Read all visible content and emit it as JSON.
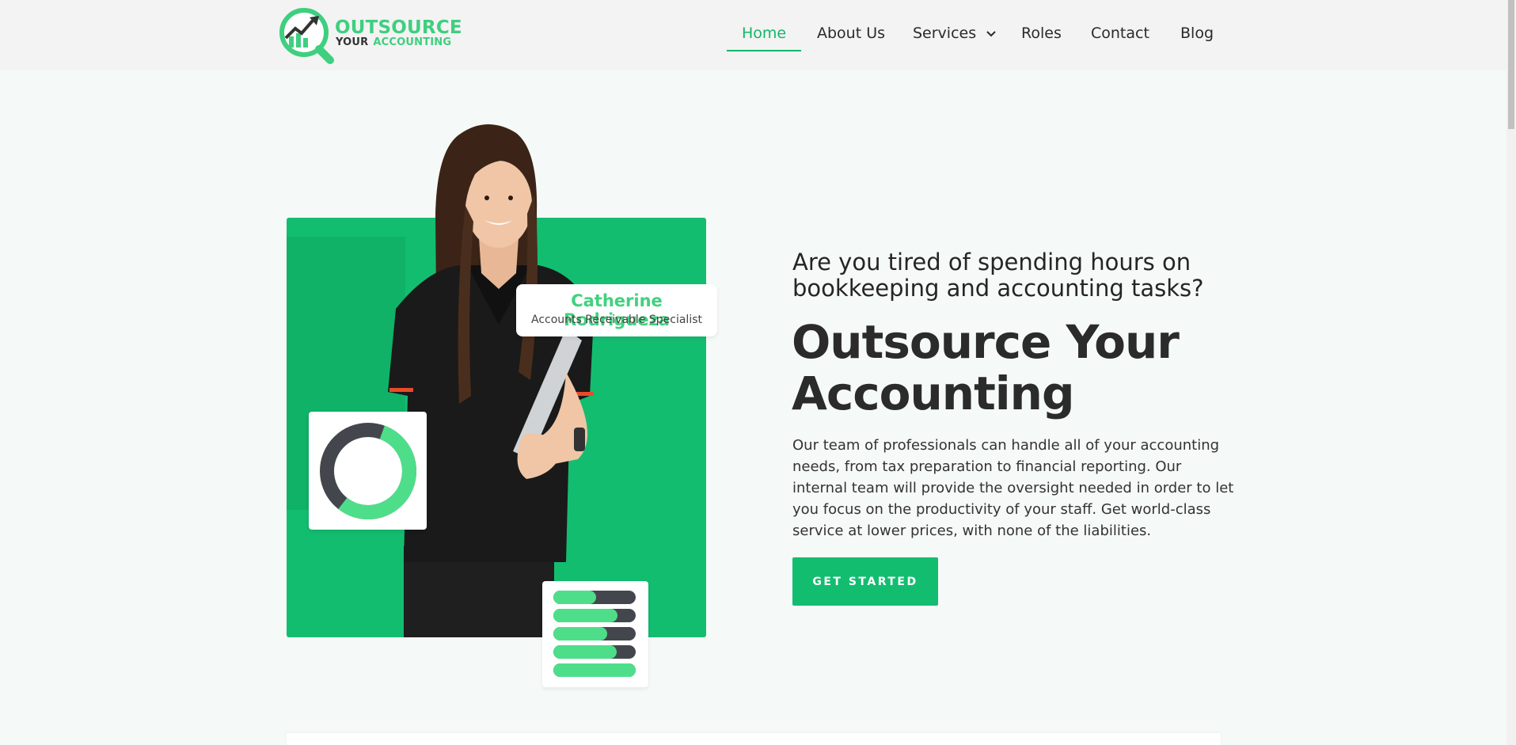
{
  "brand": {
    "line1": "OUTSOURCE",
    "line2a": "YOUR",
    "line2b": "ACCOUNTING",
    "primary_color": "#3ecf7f",
    "accent_color": "#13bd70"
  },
  "nav": {
    "items": [
      {
        "label": "Home",
        "active": true
      },
      {
        "label": "About Us"
      },
      {
        "label": "Services",
        "has_dropdown": true
      },
      {
        "label": "Roles"
      },
      {
        "label": "Contact"
      },
      {
        "label": "Blog"
      }
    ]
  },
  "hero": {
    "profile": {
      "name": "Catherine Rodrigueza",
      "role": "Accounts Receivable Specialist"
    },
    "donut_fill": 0.55,
    "progress_bars": [
      0.52,
      0.78,
      0.65,
      0.77,
      1.0
    ],
    "tagline": "Are you tired of spending hours on bookkeeping and accounting tasks?",
    "headline": "Outsource Your Accounting",
    "body": "Our team of professionals can handle all of your accounting needs, from tax preparation to financial reporting. Our internal team will provide the oversight needed in order to let you focus on the productivity of your staff. Get world-class service at lower prices, with none of the liabilities.",
    "cta_label": "GET STARTED"
  }
}
